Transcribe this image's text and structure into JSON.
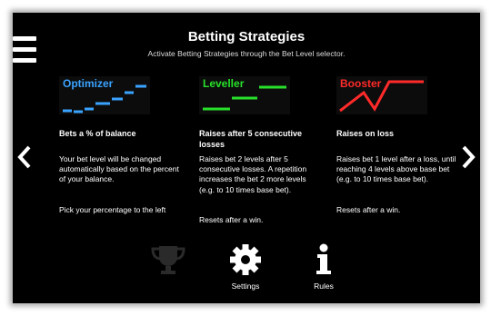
{
  "header": {
    "title": "Betting Strategies",
    "subtitle": "Activate Betting Strategies through the Bet Level selector."
  },
  "strategies": [
    {
      "name": "Optimizer",
      "color": "#3aa3ff",
      "heading": "Bets a % of balance",
      "paragraph1": "Your bet level will be changed automatically based on the percent of your balance.",
      "paragraph2": "Pick your percentage to the left"
    },
    {
      "name": "Leveller",
      "color": "#28e02a",
      "heading": "Raises after 5 consecutive losses",
      "paragraph1": "Raises bet 2 levels after 5 consecutive losses. A repetition increases the bet 2 more levels (e.g. to 10 times base bet).",
      "paragraph2": "Resets after a win."
    },
    {
      "name": "Booster",
      "color": "#ff2a2a",
      "heading": "Raises on loss",
      "paragraph1": "Raises bet 1 level after a loss, until reaching 4 levels above base bet (e.g. to 10 times base bet).",
      "paragraph2": "Resets after a win."
    }
  ],
  "nav": {
    "prev_icon": "chevron-left-icon",
    "next_icon": "chevron-right-icon",
    "menu_icon": "hamburger-menu-icon"
  },
  "bottom_bar": {
    "settings_label": "Settings",
    "rules_label": "Rules"
  }
}
